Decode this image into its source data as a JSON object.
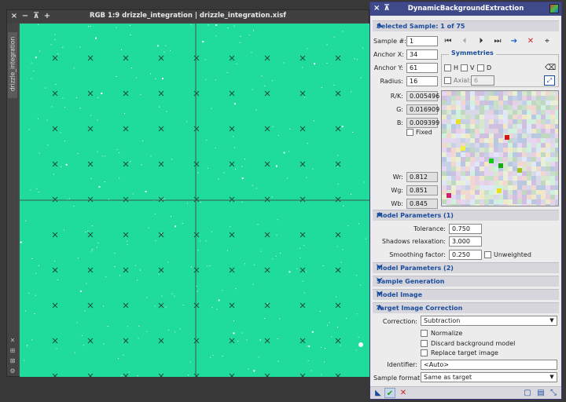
{
  "image_window": {
    "title": "RGB 1:9 drizzle_integration | drizzle_integration.xisf",
    "side_tab": "drizzle_integration",
    "controls": [
      "×",
      "−",
      "⊼",
      "+"
    ]
  },
  "dbe": {
    "title": "DynamicBackgroundExtraction",
    "sections": {
      "selected_sample": "Selected Sample: 1 of 75",
      "model_params_1": "Model Parameters (1)",
      "model_params_2": "Model Parameters (2)",
      "sample_generation": "Sample Generation",
      "model_image": "Model Image",
      "target_correction": "Target Image Correction"
    },
    "sample": {
      "number_label": "Sample #:",
      "number": "1",
      "anchor_x_label": "Anchor X:",
      "anchor_x": "34",
      "anchor_y_label": "Anchor Y:",
      "anchor_y": "61",
      "radius_label": "Radius:",
      "radius": "16"
    },
    "symmetries": {
      "title": "Symmetries",
      "h": "H",
      "v": "V",
      "d": "D",
      "axial_label": "Axial:",
      "axial_value": "6"
    },
    "values": {
      "rk_label": "R/K:",
      "rk": "0.005496",
      "g_label": "G:",
      "g": "0.016909",
      "b_label": "B:",
      "b": "0.009399",
      "fixed_label": "Fixed",
      "wr_label": "Wr:",
      "wr": "0.812",
      "wg_label": "Wg:",
      "wg": "0.851",
      "wb_label": "Wb:",
      "wb": "0.845"
    },
    "model": {
      "tolerance_label": "Tolerance:",
      "tolerance": "0.750",
      "shadows_label": "Shadows relaxation:",
      "shadows": "3.000",
      "smoothing_label": "Smoothing factor:",
      "smoothing": "0.250",
      "unweighted_label": "Unweighted"
    },
    "correction": {
      "correction_label": "Correction:",
      "correction_value": "Subtraction",
      "normalize": "Normalize",
      "discard": "Discard background model",
      "replace": "Replace target image",
      "identifier_label": "Identifier:",
      "identifier": "<Auto>",
      "sample_format_label": "Sample format:",
      "sample_format": "Same as target"
    }
  },
  "colors": {
    "image_background": "#1fdb9c",
    "title_bar": "#3f4a8a",
    "section_text": "#1b4c9c"
  }
}
